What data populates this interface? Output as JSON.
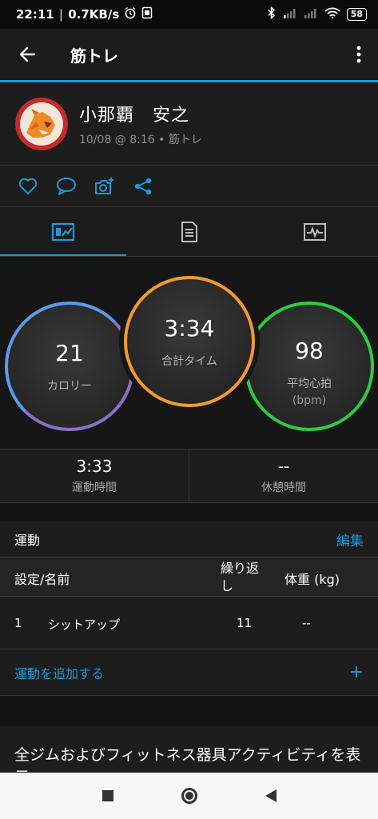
{
  "status_bar": {
    "time": "22:11",
    "speed": "0.7KB/s",
    "battery": "58",
    "icons": [
      "alarm-icon",
      "sim-icon",
      "bluetooth-icon",
      "signal-icon",
      "signal-icon",
      "wifi-icon",
      "battery-icon"
    ]
  },
  "app_bar": {
    "title": "筋トレ",
    "back_icon": "back-arrow-icon",
    "menu_icon": "more-vert-icon"
  },
  "profile": {
    "name": "小那覇　安之",
    "meta": "10/08 @ 8:16 • 筋トレ"
  },
  "actions": [
    "like-icon",
    "comment-icon",
    "add-photo-icon",
    "share-icon"
  ],
  "tabs": [
    {
      "icon": "summary-chart-icon",
      "active": true
    },
    {
      "icon": "details-icon",
      "active": false
    },
    {
      "icon": "heart-rate-chart-icon",
      "active": false
    }
  ],
  "stats": {
    "calories": {
      "value": "21",
      "label": "カロリー"
    },
    "total_time": {
      "value": "3:34",
      "label": "合計タイム"
    },
    "avg_hr": {
      "value": "98",
      "label": "平均心拍",
      "unit": "(bpm)"
    }
  },
  "times": {
    "active": {
      "value": "3:33",
      "label": "運動時間"
    },
    "rest": {
      "value": "--",
      "label": "休憩時間"
    }
  },
  "exercises": {
    "title": "運動",
    "edit": "編集",
    "columns": {
      "set_name": "設定/名前",
      "reps": "繰り返し",
      "weight": "体重 (kg)"
    },
    "rows": [
      {
        "set": "1",
        "name": "シットアップ",
        "reps": "11",
        "weight": "--"
      }
    ],
    "add_label": "運動を追加する",
    "add_plus": "+"
  },
  "gym_link": "全ジムおよびフィットネス器具アクティビティを表示",
  "colors": {
    "accent": "#1c9ad6",
    "calories_ring": "#5a8fe0",
    "time_ring": "#f29a2e",
    "hr_ring": "#2ecc40"
  }
}
